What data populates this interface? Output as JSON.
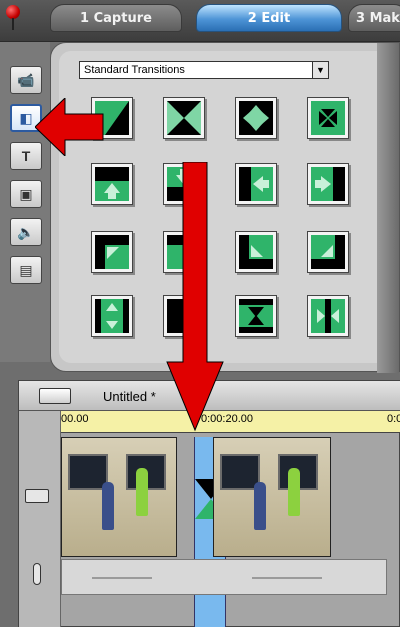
{
  "tabs": [
    {
      "label": "1 Capture"
    },
    {
      "label": "2 Edit"
    },
    {
      "label": "3 Mak"
    }
  ],
  "album": {
    "dropdown_value": "Standard Transitions"
  },
  "timeline": {
    "project_title": "Untitled *",
    "ruler": [
      "00.00",
      "0:00:20.00",
      "0:0"
    ]
  },
  "colors": {
    "accent": "#2a6fb4",
    "arrow": "#e00000",
    "transition_green": "#2fb46a"
  }
}
